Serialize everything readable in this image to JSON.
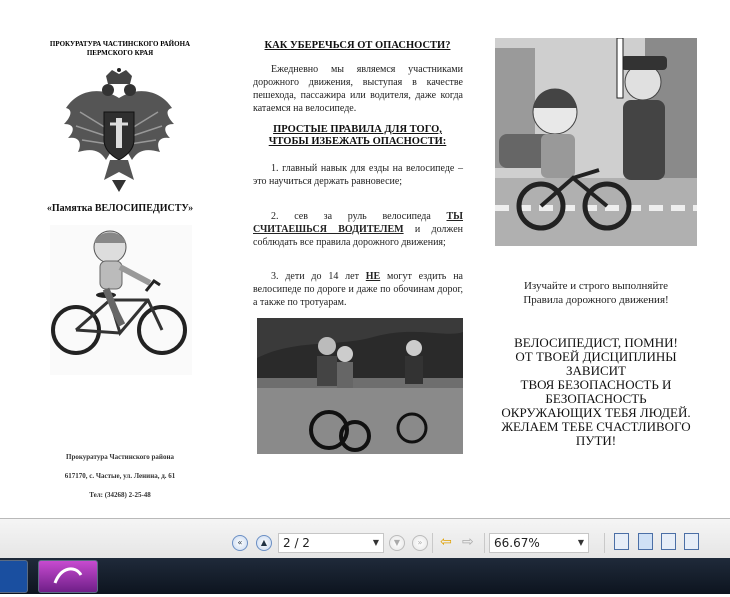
{
  "left_panel": {
    "org_line1": "ПРОКУРАТУРА ЧАСТИНСКОГО РАЙОНА",
    "org_line2": "ПЕРМСКОГО КРАЯ",
    "memo_title": "«Памятка ВЕЛОСИПЕДИСТУ»",
    "footer_org": "Прокуратура Частинского района",
    "footer_address": "617170, с. Частые, ул. Ленина, д. 61",
    "footer_phone": "Тел: (34268) 2-25-48"
  },
  "middle_panel": {
    "heading1": "КАК УБЕРЕЧЬСЯ ОТ ОПАСНОСТИ?",
    "intro": "Ежедневно мы являемся участниками дорожного движения, выступая в качестве пешехода, пассажира или водителя, даже когда катаемся на велосипеде.",
    "heading2_line1": "ПРОСТЫЕ ПРАВИЛА ДЛЯ ТОГО,",
    "heading2_line2": "ЧТОБЫ ИЗБЕЖАТЬ ОПАСНОСТИ:",
    "rule1": "1. главный навык для езды на велосипеде – это научиться держать равновесие;",
    "rule2_a": "2. сев за руль велосипеда ",
    "rule2_hl": "ТЫ СЧИТАЕШЬСЯ ВОДИТЕЛЕМ",
    "rule2_b": " и должен соблюдать все правила дорожного движения;",
    "rule3_a": "3. дети до 14 лет ",
    "rule3_hl": "НЕ",
    "rule3_b": " могут ездить на велосипеде по дороге и даже по обочинам дорог, а также по тротуарам."
  },
  "right_panel": {
    "study_line1": "Изучайте и строго выполняйте",
    "study_line2": "Правила дорожного движения!",
    "remember": [
      "ВЕЛОСИПЕДИСТ, ПОМНИ!",
      "ОТ ТВОЕЙ ДИСЦИПЛИНЫ",
      "ЗАВИСИТ",
      "ТВОЯ БЕЗОПАСНОСТЬ И",
      "БЕЗОПАСНОСТЬ",
      "ОКРУЖАЮЩИХ ТЕБЯ ЛЮДЕЙ.",
      "ЖЕЛАЕМ ТЕБЕ СЧАСТЛИВОГО",
      "ПУТИ!"
    ]
  },
  "toolbar": {
    "page_value": "2 / 2",
    "zoom_value": "66.67%"
  }
}
